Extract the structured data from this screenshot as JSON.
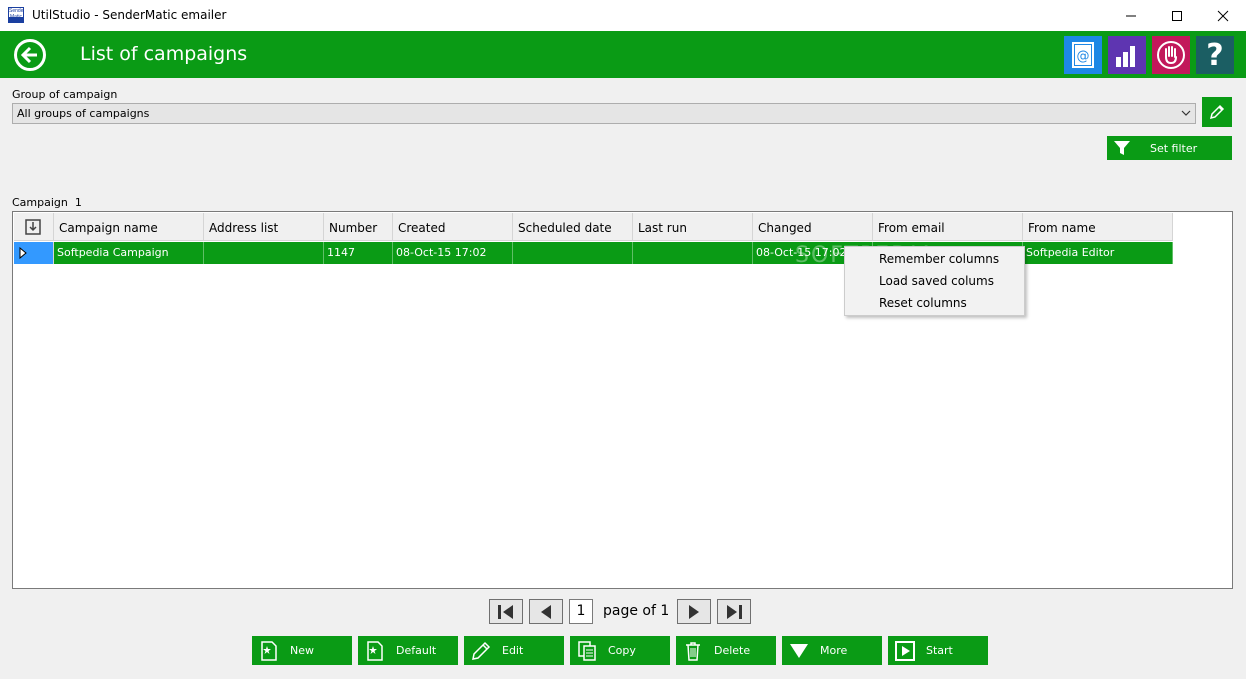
{
  "window": {
    "title": "UtilStudio - SenderMatic emailer",
    "app_icon_text": "Sender Matic"
  },
  "header": {
    "title": "List of campaigns",
    "colors": {
      "bar": "#0a9b15",
      "contacts": "#1e88e5",
      "stats": "#5e35b1",
      "stop": "#c2185b",
      "help": "#1b5e63"
    }
  },
  "filters": {
    "group_label": "Group of campaign",
    "group_value": "All groups of campaigns",
    "set_filter_label": "Set filter"
  },
  "campaign_count": {
    "label": "Campaign",
    "value": "1"
  },
  "grid": {
    "columns": [
      "Campaign name",
      "Address list",
      "Number",
      "Created",
      "Scheduled date",
      "Last run",
      "Changed",
      "From email",
      "From name"
    ],
    "rows": [
      [
        "Softpedia Campaign",
        "",
        "1147",
        "08-Oct-15 17:02",
        "",
        "",
        "08-Oct-15 17:02",
        "",
        "Softpedia Editor"
      ]
    ],
    "watermark": "SOFTPEDIA"
  },
  "context_menu": {
    "items": [
      "Remember columns",
      "Load saved colums",
      "Reset columns"
    ]
  },
  "pager": {
    "page": "1",
    "page_of": "page of 1"
  },
  "actions": [
    "New",
    "Default",
    "Edit",
    "Copy",
    "Delete",
    "More",
    "Start"
  ]
}
